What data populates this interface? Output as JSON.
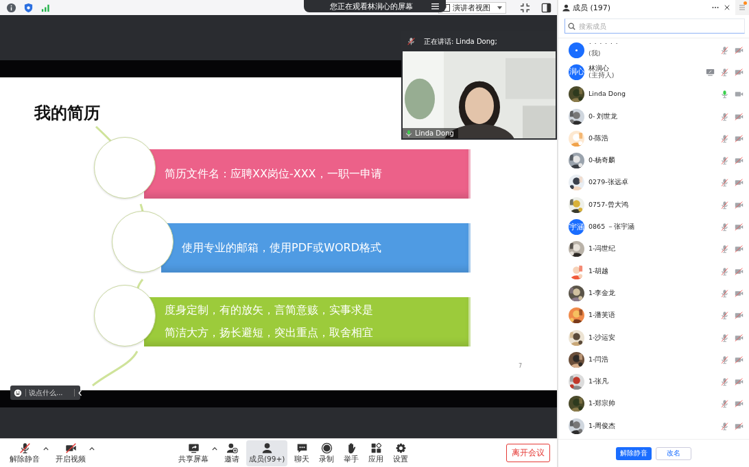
{
  "top_bar": {
    "banner": "您正在观看林润心的屏幕",
    "view_menu": "演讲者视图"
  },
  "stage": {
    "video": {
      "speaking_label": "正在讲话: Linda Dong;",
      "name": "Linda Dong",
      "mic_muted": false
    },
    "slide": {
      "title": "我的简历",
      "items": [
        {
          "color": "#ec6189",
          "lines": [
            "简历文件名：应聘XX岗位-XXX，一职一申请"
          ]
        },
        {
          "color": "#4f9be3",
          "lines": [
            "使用专业的邮箱，使用PDF或WORD格式"
          ]
        },
        {
          "color": "#9ccb3b",
          "lines": [
            "度身定制，有的放矢，言简意赅，实事求是",
            "简洁大方，扬长避短，突出重点，取舍相宜"
          ]
        }
      ],
      "page": "7"
    },
    "chat": {
      "placeholder": "说点什么..."
    }
  },
  "toolbar": {
    "left": [
      {
        "kind": "mic",
        "label": "解除静音",
        "off": true,
        "caret": true
      },
      {
        "kind": "camera",
        "label": "开启视频",
        "off": true,
        "caret": true
      }
    ],
    "center": [
      {
        "kind": "share",
        "label": "共享屏幕",
        "caret": true,
        "selected": false
      },
      {
        "kind": "invite",
        "label": "邀请",
        "caret": false,
        "selected": false
      },
      {
        "kind": "members",
        "label": "成员(99+)",
        "caret": false,
        "selected": true
      },
      {
        "kind": "chat",
        "label": "聊天",
        "caret": false,
        "selected": false
      },
      {
        "kind": "record",
        "label": "录制",
        "caret": false,
        "selected": false
      },
      {
        "kind": "hand",
        "label": "举手",
        "caret": false,
        "selected": false
      },
      {
        "kind": "apps",
        "label": "应用",
        "caret": false,
        "selected": false
      },
      {
        "kind": "settings",
        "label": "设置",
        "caret": false,
        "selected": false
      }
    ],
    "leave": "离开会议"
  },
  "panel": {
    "title": "成员 (197)",
    "notification": true,
    "search": {
      "placeholder": "搜索成员"
    },
    "members": [
      {
        "name": "˙ ˙ ˙ ˙ ˙ ˙",
        "role": "(我)",
        "avatar": {
          "kind": "dot"
        },
        "sharing": false,
        "mic_muted": true,
        "video_on": false
      },
      {
        "name": "林润心",
        "role": "(主持人)",
        "avatar": {
          "kind": "initials",
          "text": "润心"
        },
        "sharing": true,
        "mic_muted": true,
        "video_on": false
      },
      {
        "name": "Linda Dong",
        "sharing": false,
        "mic_muted": false,
        "video_on": true
      },
      {
        "name": "0- 刘世龙",
        "sharing": false,
        "mic_muted": true,
        "video_on": false
      },
      {
        "name": "0-陈浩",
        "sharing": false,
        "mic_muted": true,
        "video_on": false
      },
      {
        "name": "0-杨奇麟",
        "sharing": false,
        "mic_muted": true,
        "video_on": false
      },
      {
        "name": "0279-张远卓",
        "sharing": false,
        "mic_muted": true,
        "video_on": false
      },
      {
        "name": "0757-曾大鸿",
        "sharing": false,
        "mic_muted": true,
        "video_on": false
      },
      {
        "name": "0865 －张宇涵",
        "avatar": {
          "kind": "initials",
          "text": "宇涵"
        },
        "sharing": false,
        "mic_muted": true,
        "video_on": false
      },
      {
        "name": "1-冯世纪",
        "sharing": false,
        "mic_muted": true,
        "video_on": false
      },
      {
        "name": "1-胡越",
        "sharing": false,
        "mic_muted": true,
        "video_on": false
      },
      {
        "name": "1-李金龙",
        "sharing": false,
        "mic_muted": true,
        "video_on": false
      },
      {
        "name": "1-潘芙语",
        "sharing": false,
        "mic_muted": true,
        "video_on": false
      },
      {
        "name": "1-沙运安",
        "sharing": false,
        "mic_muted": true,
        "video_on": false
      },
      {
        "name": "1-闫浩",
        "sharing": false,
        "mic_muted": true,
        "video_on": false
      },
      {
        "name": "1-张凡",
        "sharing": false,
        "mic_muted": true,
        "video_on": false
      },
      {
        "name": "1-郑宗帅",
        "sharing": false,
        "mic_muted": true,
        "video_on": false
      },
      {
        "name": "1-周俊杰",
        "sharing": false,
        "mic_muted": true,
        "video_on": false
      }
    ],
    "buttons": [
      "解除静音",
      "改名"
    ]
  }
}
